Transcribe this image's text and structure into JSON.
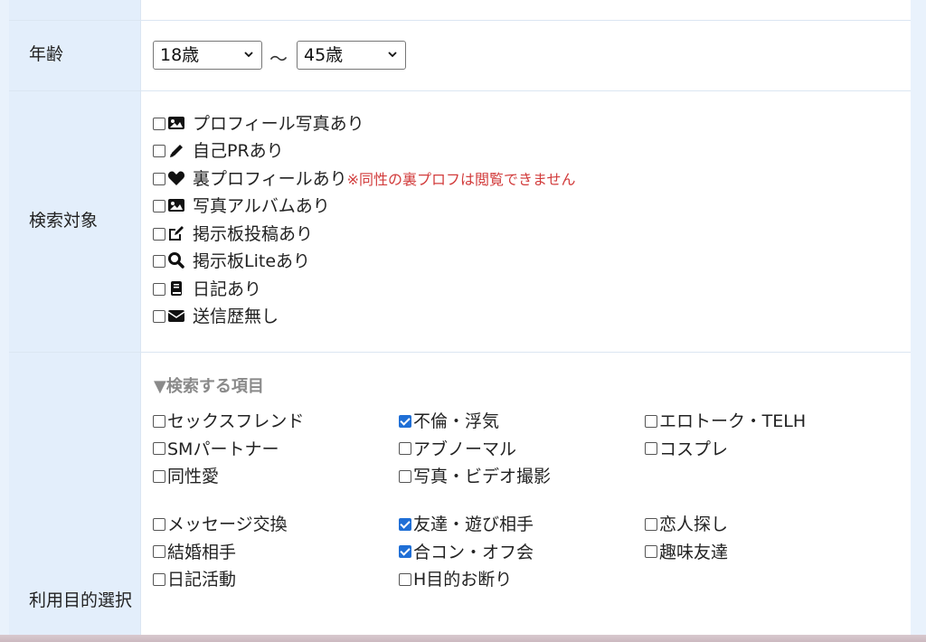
{
  "age": {
    "label": "年齢",
    "min_selected": "18歳",
    "separator": "～",
    "max_selected": "45歳"
  },
  "search_target": {
    "label": "検索対象",
    "options": [
      {
        "icon": "image-icon",
        "label": "プロフィール写真あり",
        "checked": false
      },
      {
        "icon": "pencil-icon",
        "label": "自己PRあり",
        "checked": false
      },
      {
        "icon": "heart-icon",
        "label": "裏プロフィールあり",
        "checked": false,
        "note": "※同性の裏プロフは閲覧できません"
      },
      {
        "icon": "image-icon",
        "label": "写真アルバムあり",
        "checked": false
      },
      {
        "icon": "edit-icon",
        "label": "掲示板投稿あり",
        "checked": false
      },
      {
        "icon": "search-icon",
        "label": "掲示板Liteあり",
        "checked": false
      },
      {
        "icon": "book-icon",
        "label": "日記あり",
        "checked": false
      },
      {
        "icon": "envelope-icon",
        "label": "送信歴無し",
        "checked": false
      }
    ]
  },
  "purpose": {
    "label": "利用目的選択",
    "section_title": "▼検索する項目",
    "group1": [
      {
        "label": "セックスフレンド",
        "checked": false
      },
      {
        "label": "不倫・浮気",
        "checked": true
      },
      {
        "label": "エロトーク・TELH",
        "checked": false
      },
      {
        "label": "SMパートナー",
        "checked": false
      },
      {
        "label": "アブノーマル",
        "checked": false
      },
      {
        "label": "コスプレ",
        "checked": false
      },
      {
        "label": "同性愛",
        "checked": false
      },
      {
        "label": "写真・ビデオ撮影",
        "checked": false
      }
    ],
    "group2": [
      {
        "label": "メッセージ交換",
        "checked": false
      },
      {
        "label": "友達・遊び相手",
        "checked": true
      },
      {
        "label": "恋人探し",
        "checked": false
      },
      {
        "label": "結婚相手",
        "checked": false
      },
      {
        "label": "合コン・オフ会",
        "checked": true
      },
      {
        "label": "趣味友達",
        "checked": false
      },
      {
        "label": "日記活動",
        "checked": false
      },
      {
        "label": "H目的お断り",
        "checked": false
      }
    ]
  },
  "colors": {
    "label_bg": "#e3eefb",
    "checkbox_checked": "#1f6fd6",
    "warning": "#d23c3c",
    "section_title": "#8a8a8a"
  }
}
